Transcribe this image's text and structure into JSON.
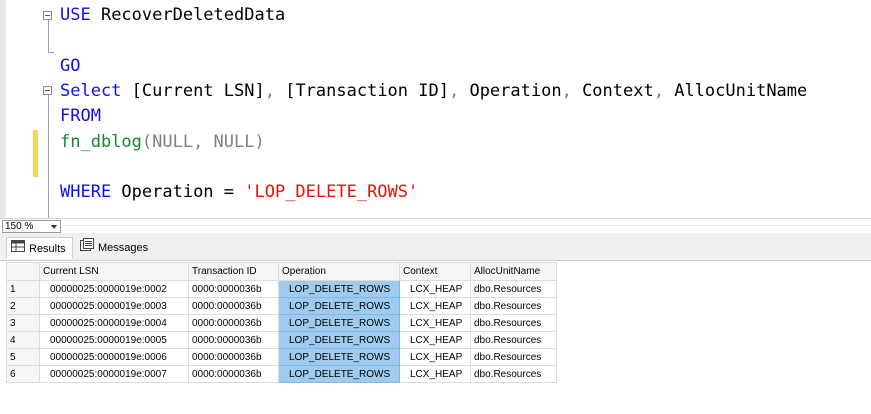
{
  "editor": {
    "lines": {
      "l1": {
        "kw": "USE",
        "plain": " RecoverDeletedData"
      },
      "l2": {
        "kw": "GO"
      },
      "l3": {
        "kw1": "Select",
        "p1": " [Current LSN]",
        "c1": ",",
        "p2": " [Transaction ID]",
        "c2": ",",
        "p3": " Operation",
        "c3": ",",
        "p4": " Context",
        "c4": ",",
        "p5": " AllocUnitName"
      },
      "l4": {
        "kw": "FROM"
      },
      "l5": {
        "fn": "fn_dblog",
        "args": "(NULL, NULL)"
      },
      "l6": {
        "kw": "WHERE",
        "p1": " Operation = ",
        "str": "'LOP_DELETE_ROWS'"
      }
    }
  },
  "zoom": {
    "value": "150 %"
  },
  "tabs": {
    "results": "Results",
    "messages": "Messages"
  },
  "grid": {
    "columns": [
      "",
      "Current LSN",
      "Transaction ID",
      "Operation",
      "Context",
      "AllocUnitName"
    ],
    "rows": [
      [
        "1",
        "00000025:0000019e:0002",
        "0000:0000036b",
        "LOP_DELETE_ROWS",
        "LCX_HEAP",
        "dbo.Resources"
      ],
      [
        "2",
        "00000025:0000019e:0003",
        "0000:0000036b",
        "LOP_DELETE_ROWS",
        "LCX_HEAP",
        "dbo.Resources"
      ],
      [
        "3",
        "00000025:0000019e:0004",
        "0000:0000036b",
        "LOP_DELETE_ROWS",
        "LCX_HEAP",
        "dbo.Resources"
      ],
      [
        "4",
        "00000025:0000019e:0005",
        "0000:0000036b",
        "LOP_DELETE_ROWS",
        "LCX_HEAP",
        "dbo.Resources"
      ],
      [
        "5",
        "00000025:0000019e:0006",
        "0000:0000036b",
        "LOP_DELETE_ROWS",
        "LCX_HEAP",
        "dbo.Resources"
      ],
      [
        "6",
        "00000025:0000019e:0007",
        "0000:0000036b",
        "LOP_DELETE_ROWS",
        "LCX_HEAP",
        "dbo.Resources"
      ]
    ]
  },
  "colors": {
    "selection": "#9fcbef",
    "keyword": "#1010e6",
    "string": "#e4160a",
    "function": "#118a2c",
    "changeMarker": "#f3d35a"
  },
  "icons": {
    "results_tab": "grid-icon",
    "messages_tab": "messages-icon",
    "collapse": "collapse-minus-icon"
  }
}
